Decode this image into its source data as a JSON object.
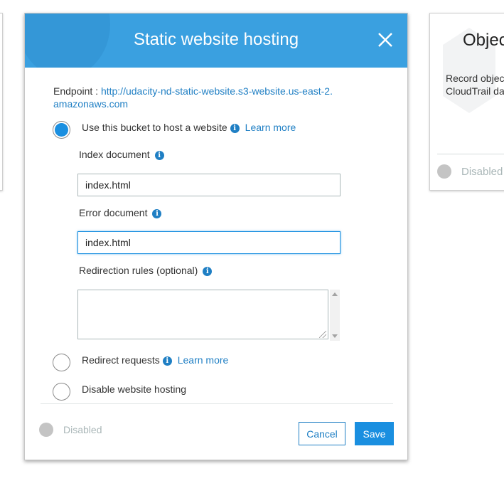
{
  "modal": {
    "title": "Static website hosting",
    "endpoint_label": "Endpoint : ",
    "endpoint_url": "http://udacity-nd-static-website.s3-website.us-east-2.amazonaws.com",
    "options": [
      {
        "label": "Use this bucket to host a website",
        "selected": true,
        "learn_more": "Learn more"
      },
      {
        "label": "Redirect requests",
        "selected": false,
        "learn_more": "Learn more"
      },
      {
        "label": "Disable website hosting",
        "selected": false
      }
    ],
    "index_document": {
      "label": "Index document",
      "value": "index.html"
    },
    "error_document": {
      "label": "Error document",
      "value": "index.html"
    },
    "redirection_rules": {
      "label": "Redirection rules (optional)",
      "value": ""
    },
    "status": "Disabled",
    "cancel_label": "Cancel",
    "save_label": "Save"
  },
  "right_card": {
    "title": "Objec",
    "description_line1": "Record objec",
    "description_line2": "CloudTrail da",
    "status": "Disabled"
  },
  "colors": {
    "header": "#3aa0e0",
    "accent": "#1a8fe0",
    "link": "#1f7fc4"
  }
}
